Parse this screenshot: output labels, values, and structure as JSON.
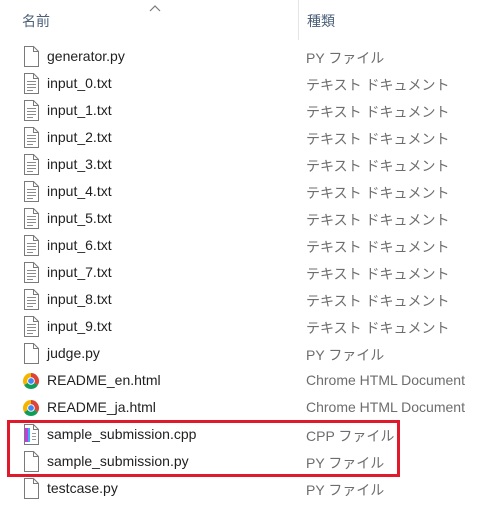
{
  "header": {
    "name_label": "名前",
    "type_label": "種類"
  },
  "files": [
    {
      "name": "generator.py",
      "type": "PY ファイル",
      "icon": "blank-file-icon"
    },
    {
      "name": "input_0.txt",
      "type": "テキスト ドキュメント",
      "icon": "text-file-icon"
    },
    {
      "name": "input_1.txt",
      "type": "テキスト ドキュメント",
      "icon": "text-file-icon"
    },
    {
      "name": "input_2.txt",
      "type": "テキスト ドキュメント",
      "icon": "text-file-icon"
    },
    {
      "name": "input_3.txt",
      "type": "テキスト ドキュメント",
      "icon": "text-file-icon"
    },
    {
      "name": "input_4.txt",
      "type": "テキスト ドキュメント",
      "icon": "text-file-icon"
    },
    {
      "name": "input_5.txt",
      "type": "テキスト ドキュメント",
      "icon": "text-file-icon"
    },
    {
      "name": "input_6.txt",
      "type": "テキスト ドキュメント",
      "icon": "text-file-icon"
    },
    {
      "name": "input_7.txt",
      "type": "テキスト ドキュメント",
      "icon": "text-file-icon"
    },
    {
      "name": "input_8.txt",
      "type": "テキスト ドキュメント",
      "icon": "text-file-icon"
    },
    {
      "name": "input_9.txt",
      "type": "テキスト ドキュメント",
      "icon": "text-file-icon"
    },
    {
      "name": "judge.py",
      "type": "PY ファイル",
      "icon": "blank-file-icon"
    },
    {
      "name": "README_en.html",
      "type": "Chrome HTML Document",
      "icon": "chrome-icon"
    },
    {
      "name": "README_ja.html",
      "type": "Chrome HTML Document",
      "icon": "chrome-icon"
    },
    {
      "name": "sample_submission.cpp",
      "type": "CPP ファイル",
      "icon": "cpp-file-icon"
    },
    {
      "name": "sample_submission.py",
      "type": "PY ファイル",
      "icon": "blank-file-icon"
    },
    {
      "name": "testcase.py",
      "type": "PY ファイル",
      "icon": "blank-file-icon"
    }
  ],
  "colors": {
    "highlight": "#e01a2a"
  }
}
